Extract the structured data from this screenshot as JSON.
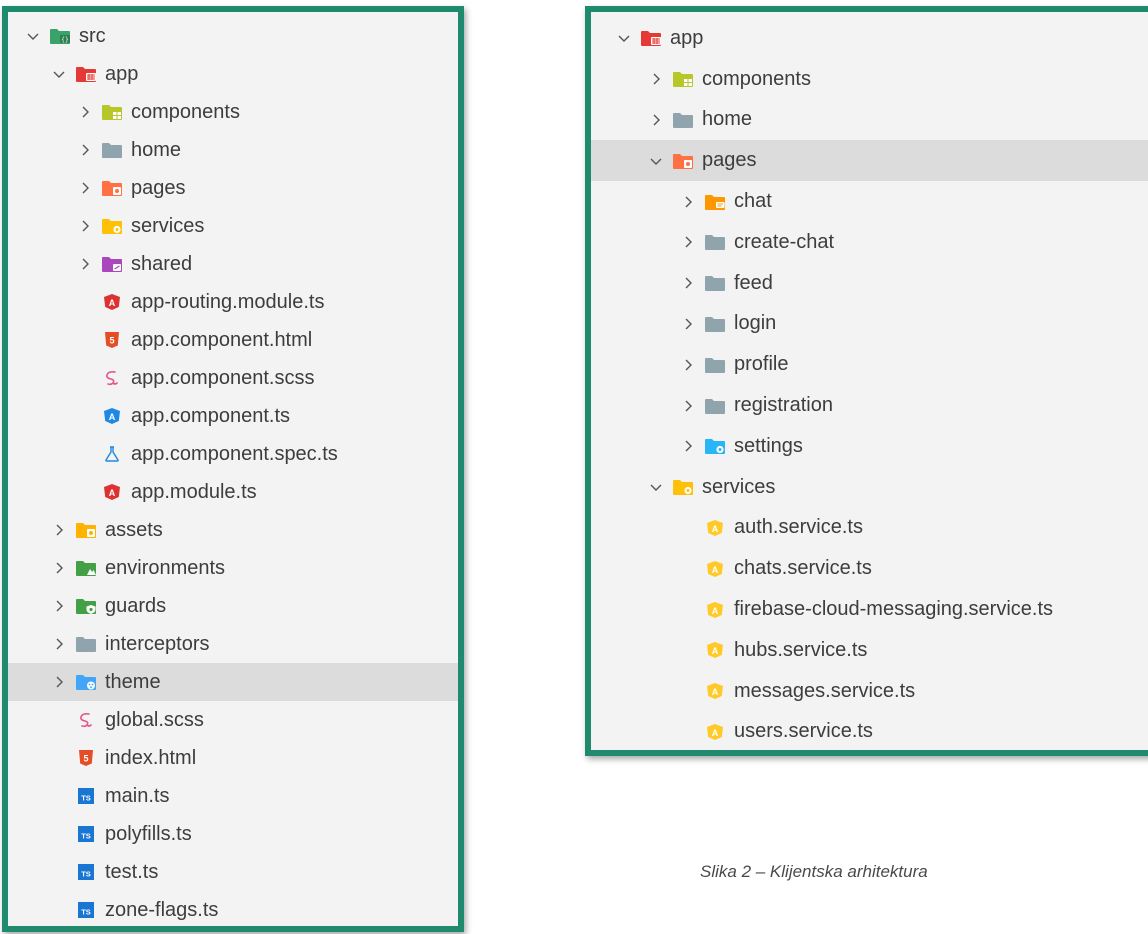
{
  "left_tree": [
    {
      "label": "src",
      "depth": 0,
      "kind": "folder",
      "expanded": true,
      "color": "#3aa36a",
      "badge": "src"
    },
    {
      "label": "app",
      "depth": 1,
      "kind": "folder",
      "expanded": true,
      "color": "#e53935",
      "badge": "app"
    },
    {
      "label": "components",
      "depth": 2,
      "kind": "folder",
      "expanded": false,
      "color": "#b7c629",
      "badge": "grid"
    },
    {
      "label": "home",
      "depth": 2,
      "kind": "folder",
      "expanded": false,
      "color": "#90a4ae",
      "badge": "plain"
    },
    {
      "label": "pages",
      "depth": 2,
      "kind": "folder",
      "expanded": false,
      "color": "#ff7043",
      "badge": "page"
    },
    {
      "label": "services",
      "depth": 2,
      "kind": "folder",
      "expanded": false,
      "color": "#ffc107",
      "badge": "gear"
    },
    {
      "label": "shared",
      "depth": 2,
      "kind": "folder",
      "expanded": false,
      "color": "#ab47bc",
      "badge": "share"
    },
    {
      "label": "app-routing.module.ts",
      "depth": 2,
      "kind": "file",
      "icon": "angular-red-icon"
    },
    {
      "label": "app.component.html",
      "depth": 2,
      "kind": "file",
      "icon": "html5-icon"
    },
    {
      "label": "app.component.scss",
      "depth": 2,
      "kind": "file",
      "icon": "sass-icon"
    },
    {
      "label": "app.component.ts",
      "depth": 2,
      "kind": "file",
      "icon": "angular-blue-icon"
    },
    {
      "label": "app.component.spec.ts",
      "depth": 2,
      "kind": "file",
      "icon": "flask-icon"
    },
    {
      "label": "app.module.ts",
      "depth": 2,
      "kind": "file",
      "icon": "angular-red-icon"
    },
    {
      "label": "assets",
      "depth": 1,
      "kind": "folder",
      "expanded": false,
      "color": "#ffb300",
      "badge": "page"
    },
    {
      "label": "environments",
      "depth": 1,
      "kind": "folder",
      "expanded": false,
      "color": "#43a047",
      "badge": "leaf"
    },
    {
      "label": "guards",
      "depth": 1,
      "kind": "folder",
      "expanded": false,
      "color": "#43a047",
      "badge": "shield"
    },
    {
      "label": "interceptors",
      "depth": 1,
      "kind": "folder",
      "expanded": false,
      "color": "#90a4ae",
      "badge": "plain"
    },
    {
      "label": "theme",
      "depth": 1,
      "kind": "folder",
      "expanded": false,
      "color": "#42a5f5",
      "badge": "palette",
      "selected": true
    },
    {
      "label": "global.scss",
      "depth": 1,
      "kind": "file",
      "icon": "sass-icon"
    },
    {
      "label": "index.html",
      "depth": 1,
      "kind": "file",
      "icon": "html5-icon"
    },
    {
      "label": "main.ts",
      "depth": 1,
      "kind": "file",
      "icon": "typescript-icon"
    },
    {
      "label": "polyfills.ts",
      "depth": 1,
      "kind": "file",
      "icon": "typescript-icon"
    },
    {
      "label": "test.ts",
      "depth": 1,
      "kind": "file",
      "icon": "typescript-icon"
    },
    {
      "label": "zone-flags.ts",
      "depth": 1,
      "kind": "file",
      "icon": "typescript-icon"
    }
  ],
  "right_tree": [
    {
      "label": "app",
      "depth": 0,
      "kind": "folder",
      "expanded": true,
      "color": "#e53935",
      "badge": "app"
    },
    {
      "label": "components",
      "depth": 1,
      "kind": "folder",
      "expanded": false,
      "color": "#b7c629",
      "badge": "grid"
    },
    {
      "label": "home",
      "depth": 1,
      "kind": "folder",
      "expanded": false,
      "color": "#90a4ae",
      "badge": "plain"
    },
    {
      "label": "pages",
      "depth": 1,
      "kind": "folder",
      "expanded": true,
      "color": "#ff7043",
      "badge": "page",
      "selected": true
    },
    {
      "label": "chat",
      "depth": 2,
      "kind": "folder",
      "expanded": false,
      "color": "#ff9800",
      "badge": "chat"
    },
    {
      "label": "create-chat",
      "depth": 2,
      "kind": "folder",
      "expanded": false,
      "color": "#90a4ae",
      "badge": "plain"
    },
    {
      "label": "feed",
      "depth": 2,
      "kind": "folder",
      "expanded": false,
      "color": "#90a4ae",
      "badge": "plain"
    },
    {
      "label": "login",
      "depth": 2,
      "kind": "folder",
      "expanded": false,
      "color": "#90a4ae",
      "badge": "plain"
    },
    {
      "label": "profile",
      "depth": 2,
      "kind": "folder",
      "expanded": false,
      "color": "#90a4ae",
      "badge": "plain"
    },
    {
      "label": "registration",
      "depth": 2,
      "kind": "folder",
      "expanded": false,
      "color": "#90a4ae",
      "badge": "plain"
    },
    {
      "label": "settings",
      "depth": 2,
      "kind": "folder",
      "expanded": false,
      "color": "#29b6f6",
      "badge": "gear"
    },
    {
      "label": "services",
      "depth": 1,
      "kind": "folder",
      "expanded": true,
      "color": "#ffc107",
      "badge": "gear"
    },
    {
      "label": "auth.service.ts",
      "depth": 2,
      "kind": "file",
      "icon": "angular-service-icon"
    },
    {
      "label": "chats.service.ts",
      "depth": 2,
      "kind": "file",
      "icon": "angular-service-icon"
    },
    {
      "label": "firebase-cloud-messaging.service.ts",
      "depth": 2,
      "kind": "file",
      "icon": "angular-service-icon"
    },
    {
      "label": "hubs.service.ts",
      "depth": 2,
      "kind": "file",
      "icon": "angular-service-icon"
    },
    {
      "label": "messages.service.ts",
      "depth": 2,
      "kind": "file",
      "icon": "angular-service-icon"
    },
    {
      "label": "users.service.ts",
      "depth": 2,
      "kind": "file",
      "icon": "angular-service-icon"
    }
  ],
  "caption": "Slika 2 – Klijentska arhitektura",
  "colors": {
    "frame": "#1f8a6e",
    "panel_bg": "#f3f3f3",
    "selected_bg": "#dcdcdc",
    "text": "#3d3d3d"
  }
}
